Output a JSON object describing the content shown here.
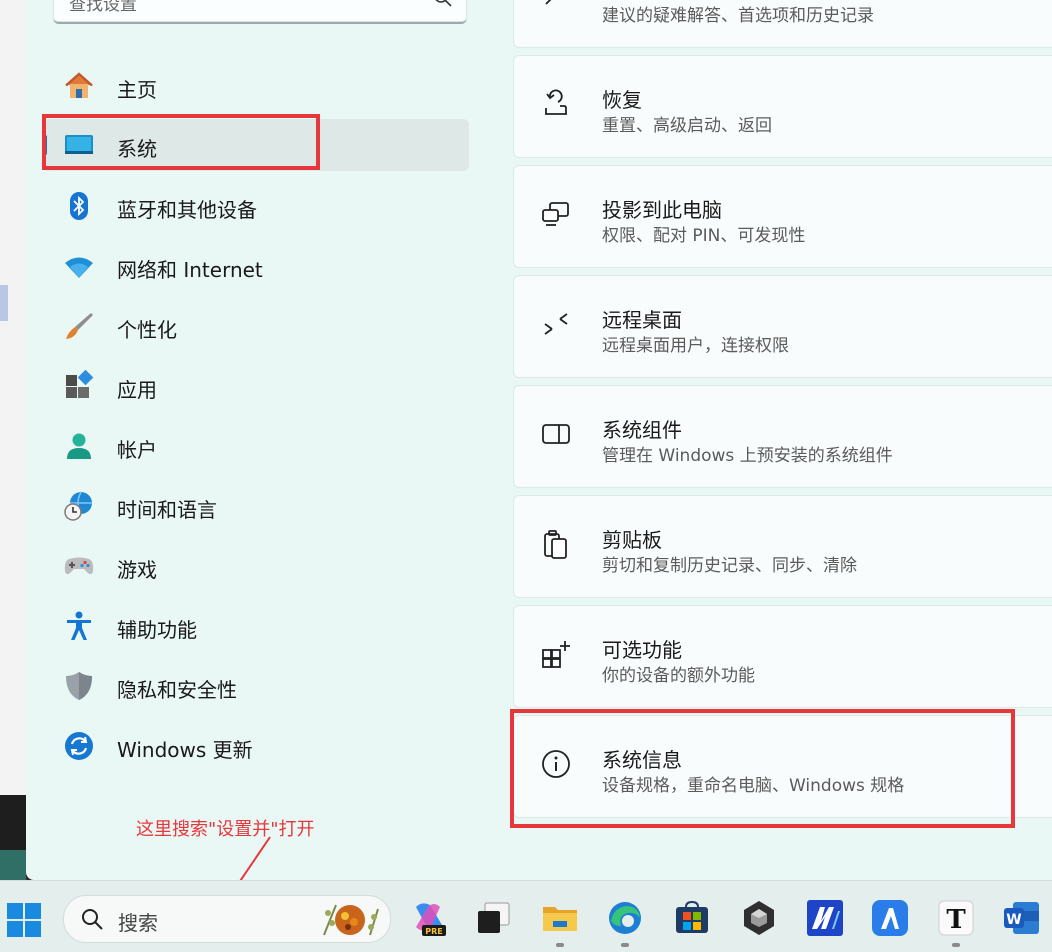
{
  "search": {
    "placeholder": "查找设置"
  },
  "nav": [
    {
      "id": "home",
      "label": "主页"
    },
    {
      "id": "system",
      "label": "系统"
    },
    {
      "id": "bluetooth",
      "label": "蓝牙和其他设备"
    },
    {
      "id": "network",
      "label": "网络和 Internet"
    },
    {
      "id": "personalization",
      "label": "个性化"
    },
    {
      "id": "apps",
      "label": "应用"
    },
    {
      "id": "accounts",
      "label": "帐户"
    },
    {
      "id": "time",
      "label": "时间和语言"
    },
    {
      "id": "gaming",
      "label": "游戏"
    },
    {
      "id": "accessibility",
      "label": "辅助功能"
    },
    {
      "id": "privacy",
      "label": "隐私和安全性"
    },
    {
      "id": "update",
      "label": "Windows 更新"
    }
  ],
  "cards": [
    {
      "id": "troubleshoot",
      "title": "",
      "sub": "建议的疑难解答、首选项和历史记录"
    },
    {
      "id": "recovery",
      "title": "恢复",
      "sub": "重置、高级启动、返回"
    },
    {
      "id": "projection",
      "title": "投影到此电脑",
      "sub": "权限、配对 PIN、可发现性"
    },
    {
      "id": "remote-desktop",
      "title": "远程桌面",
      "sub": "远程桌面用户，连接权限"
    },
    {
      "id": "components",
      "title": "系统组件",
      "sub": "管理在 Windows 上预安装的系统组件"
    },
    {
      "id": "clipboard",
      "title": "剪贴板",
      "sub": "剪切和复制历史记录、同步、清除"
    },
    {
      "id": "optional",
      "title": "可选功能",
      "sub": "你的设备的额外功能"
    },
    {
      "id": "about",
      "title": "系统信息",
      "sub": "设备规格，重命名电脑、Windows 规格"
    }
  ],
  "annotation": "这里搜索\"设置并\"打开",
  "taskbar": {
    "search_label": "搜索",
    "copilot_badge": "PRE",
    "text_app": "T",
    "word_app": "W"
  },
  "colors": {
    "accent": "#1a6fb9",
    "highlight": "#e8373b",
    "background": "#e9f7f5"
  }
}
